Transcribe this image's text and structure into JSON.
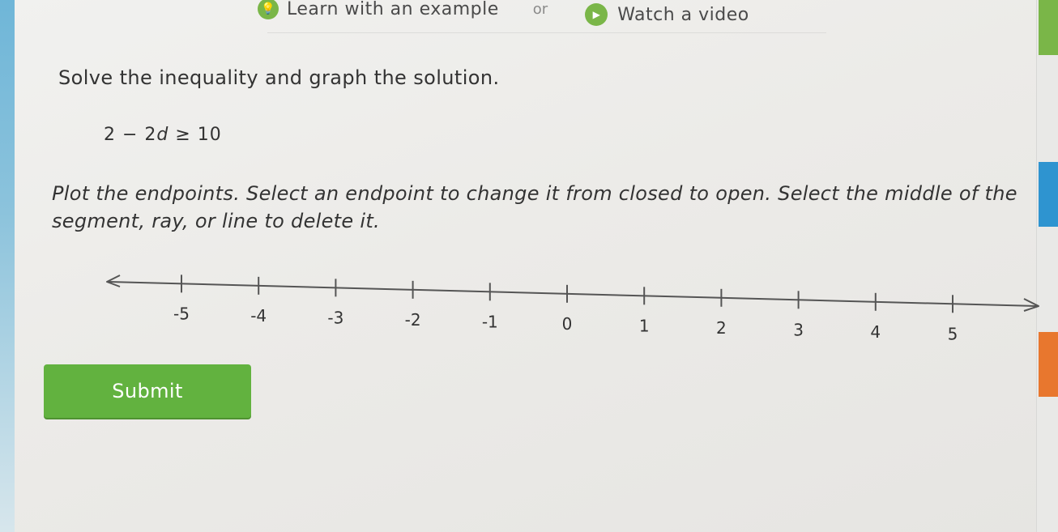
{
  "help": {
    "learn_label": "Learn with an example",
    "or_label": "or",
    "video_label": "Watch a video",
    "bulb_icon": "lightbulb-icon",
    "play_icon": "play-icon"
  },
  "question": {
    "instruction": "Solve the inequality and graph the solution.",
    "equation_lhs": "2 − 2",
    "equation_var": "d",
    "equation_rhs": " ≥ 10",
    "plot_instructions": "Plot the endpoints. Select an endpoint to change it from closed to open. Select the middle of the segment, ray, or line to delete it."
  },
  "number_line": {
    "ticks": [
      "-5",
      "-4",
      "-3",
      "-2",
      "-1",
      "0",
      "1",
      "2",
      "3",
      "4",
      "5"
    ],
    "arrows": "both"
  },
  "actions": {
    "submit_label": "Submit"
  },
  "colors": {
    "accent_green": "#62b23f",
    "side_blue": "#2e94d0",
    "side_orange": "#e8772e"
  }
}
